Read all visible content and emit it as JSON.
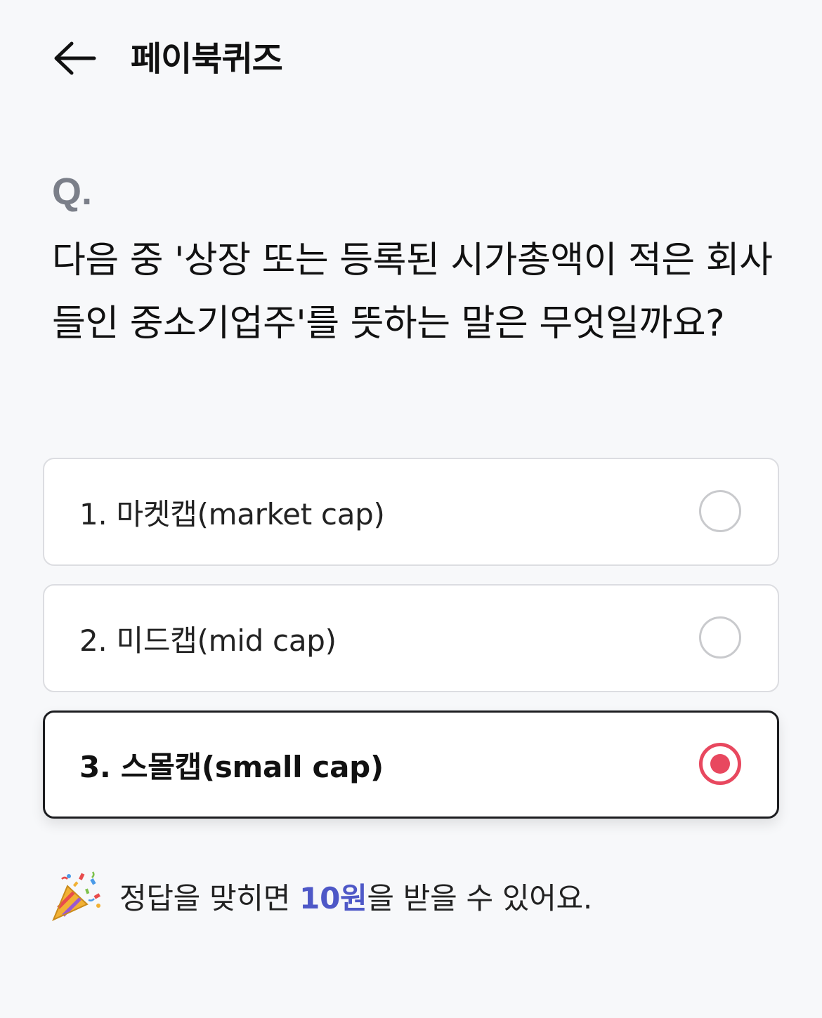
{
  "header": {
    "title": "페이북퀴즈",
    "back_icon": "arrow-left-icon"
  },
  "quiz": {
    "q_label": "Q.",
    "question": "다음 중 '상장 또는 등록된 시가총액이 적은 회사들인 중소기업주'를 뜻하는 말은 무엇일까요?",
    "options": [
      {
        "label": "1. 마켓캡(market cap)",
        "selected": false
      },
      {
        "label": "2. 미드캡(mid cap)",
        "selected": false
      },
      {
        "label": "3. 스몰캡(small cap)",
        "selected": true
      }
    ]
  },
  "reward": {
    "icon": "party-popper-icon",
    "prefix": "정답을 맞히면 ",
    "amount": "10원",
    "suffix": "을 받을 수 있어요."
  },
  "colors": {
    "background": "#f7f8fa",
    "accent_radio": "#e8485f",
    "reward_amount": "#4e58c7",
    "q_label": "#7b7f89"
  }
}
